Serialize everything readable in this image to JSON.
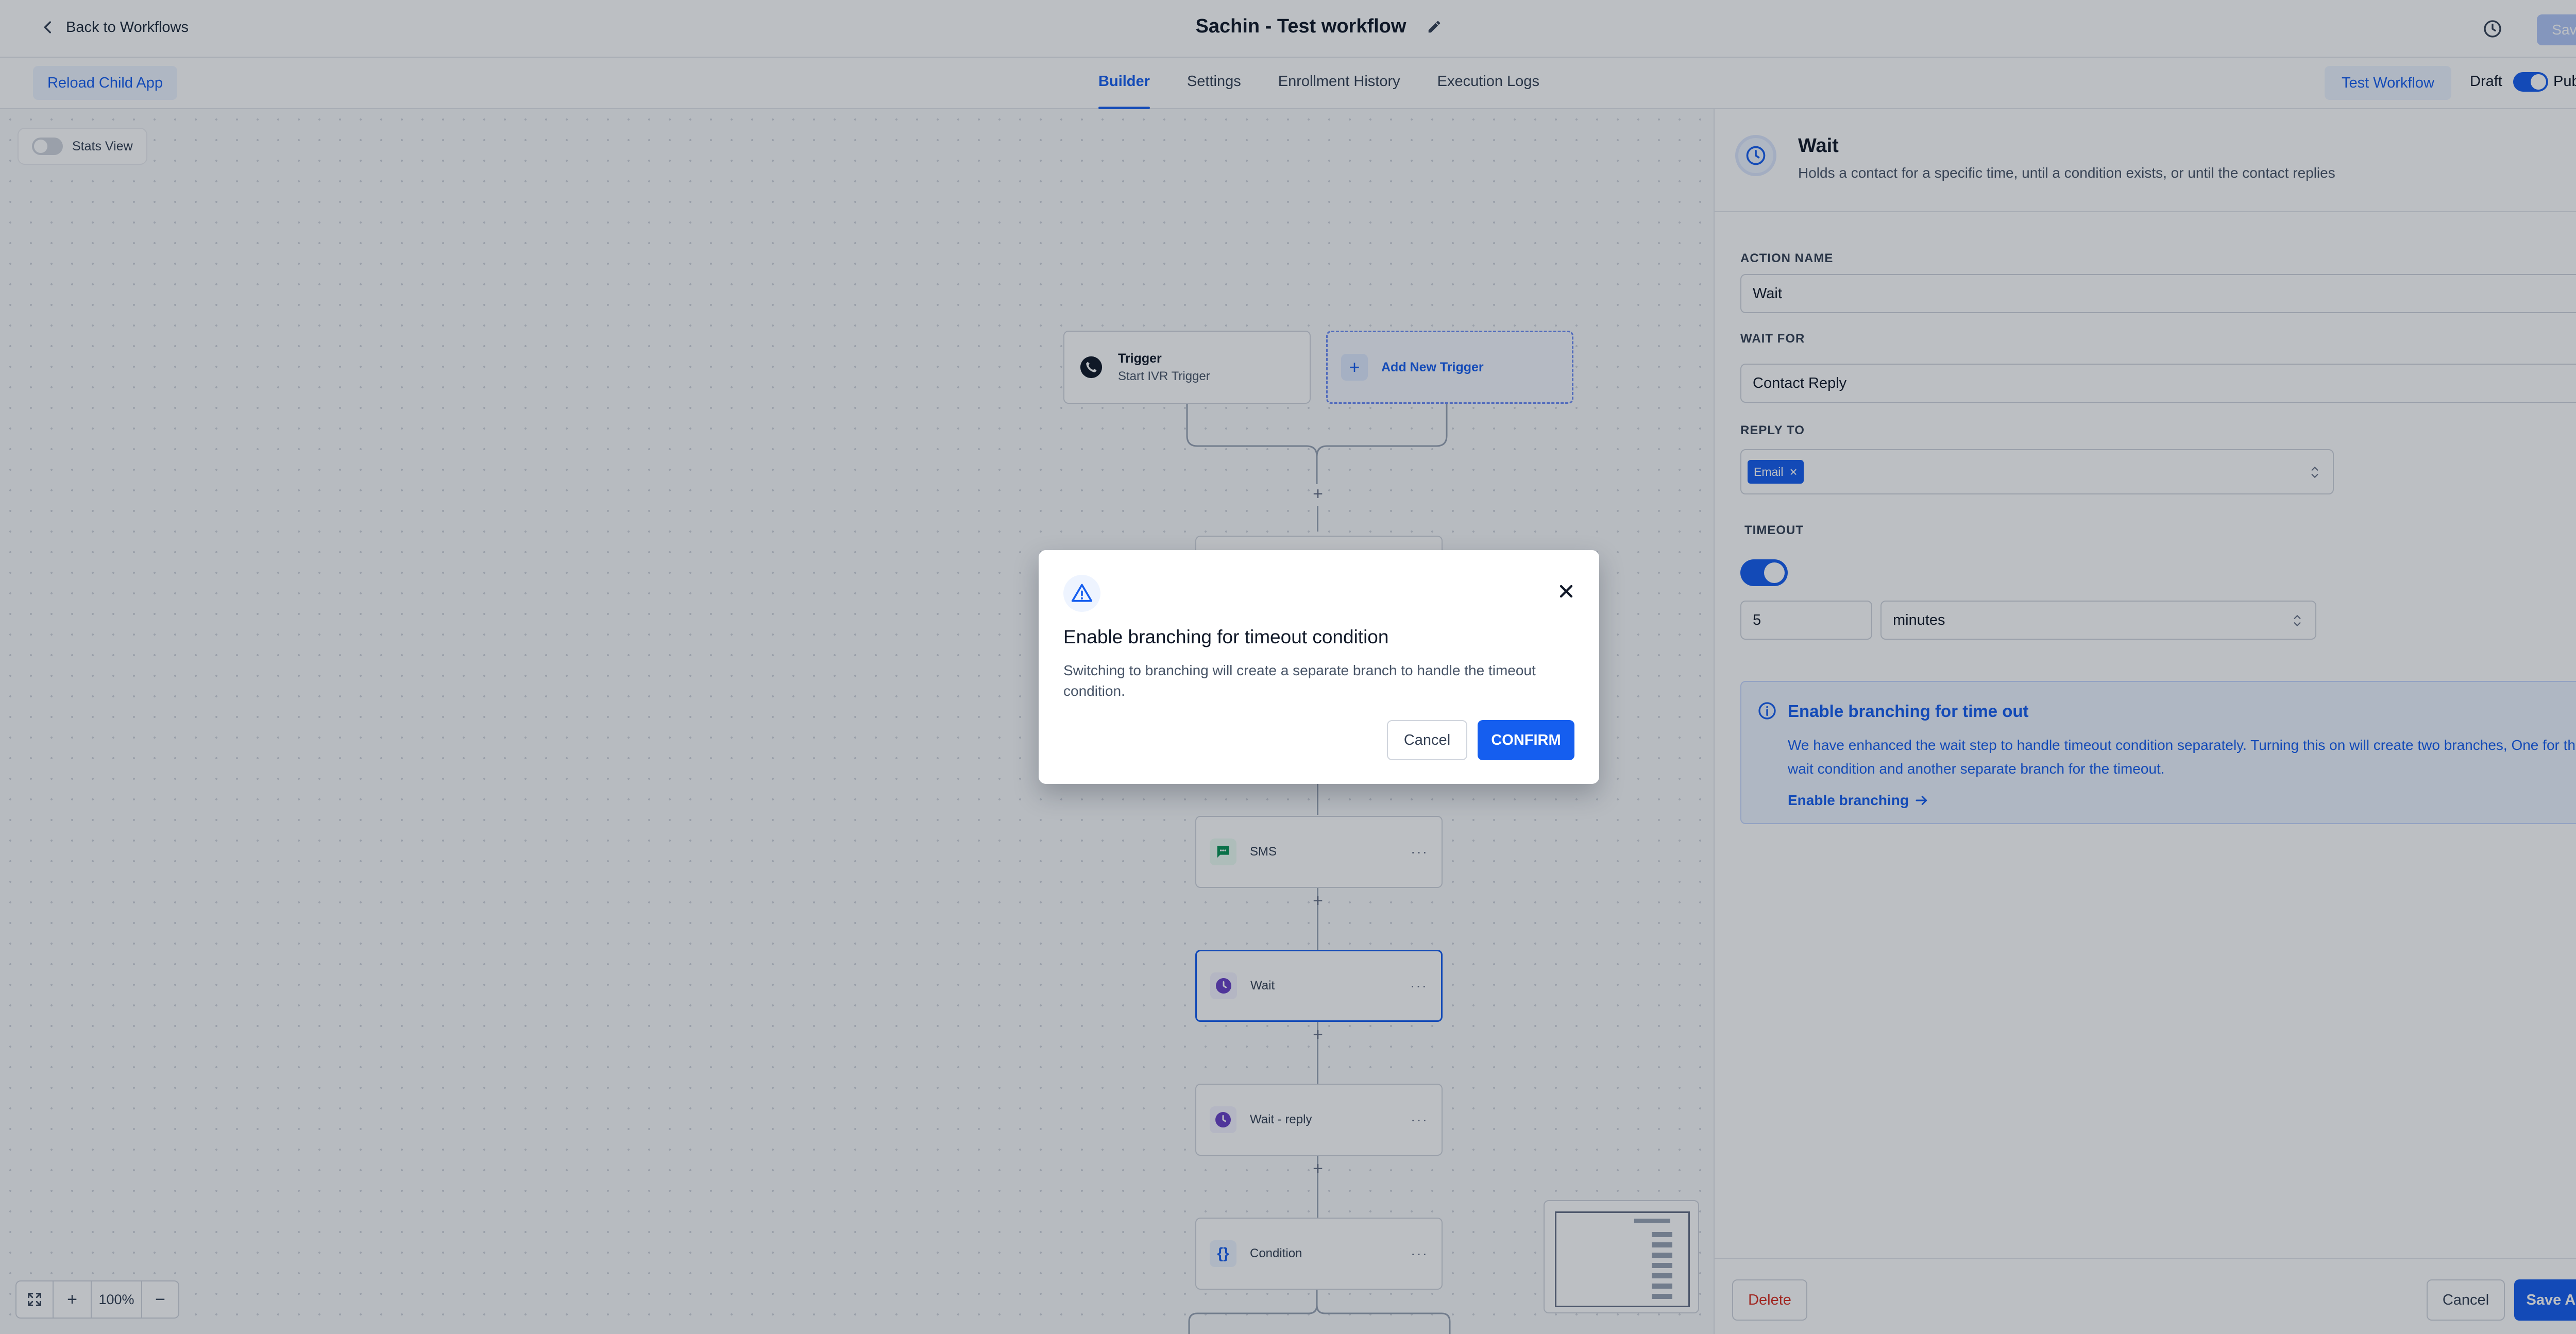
{
  "header": {
    "back_label": "Back to Workflows",
    "workflow_title": "Sachin - Test workflow",
    "saved_label": "Saved"
  },
  "subbar": {
    "reload_label": "Reload Child App",
    "tabs": [
      {
        "label": "Builder",
        "active": true
      },
      {
        "label": "Settings",
        "active": false
      },
      {
        "label": "Enrollment History",
        "active": false
      },
      {
        "label": "Execution Logs",
        "active": false
      }
    ],
    "test_label": "Test Workflow",
    "draft_label": "Draft",
    "publish_label": "Publish",
    "publish_on": true
  },
  "canvas": {
    "stats_label": "Stats View",
    "stats_on": false,
    "trigger": {
      "title": "Trigger",
      "subtitle": "Start IVR Trigger"
    },
    "add_trigger_label": "Add New Trigger",
    "nodes": [
      {
        "label": "SMS",
        "icon": "message-icon"
      },
      {
        "label": "Wait",
        "icon": "clock-icon",
        "selected": true
      },
      {
        "label": "Wait - reply",
        "icon": "clock-icon"
      },
      {
        "label": "Condition",
        "icon": "braces-icon"
      }
    ],
    "zoom_level": "100%"
  },
  "panel": {
    "title": "Wait",
    "description": "Holds a contact for a specific time, until a condition exists, or until the contact replies",
    "action_name_label": "ACTION NAME",
    "action_name_value": "Wait",
    "wait_for_label": "WAIT FOR",
    "wait_for_value": "Contact Reply",
    "reply_to_label": "REPLY TO",
    "reply_to_chip": "Email",
    "timeout_label": "TIMEOUT",
    "timeout_on": true,
    "timeout_value": "5",
    "timeout_unit": "minutes",
    "info": {
      "title": "Enable branching for time out",
      "text": "We have enhanced the wait step to handle timeout condition separately. Turning this on will create two branches, One for the wait condition and another separate branch for the timeout.",
      "link": "Enable branching"
    },
    "delete_label": "Delete",
    "cancel_label": "Cancel",
    "save_label": "Save Action"
  },
  "modal": {
    "title": "Enable branching for timeout condition",
    "text": "Switching to branching will create a separate branch to handle the timeout condition.",
    "cancel_label": "Cancel",
    "confirm_label": "CONFIRM"
  },
  "colors": {
    "accent": "#155eef",
    "danger": "#d92d20",
    "wait_icon": "#6941c6",
    "sms_icon": "#079455"
  }
}
